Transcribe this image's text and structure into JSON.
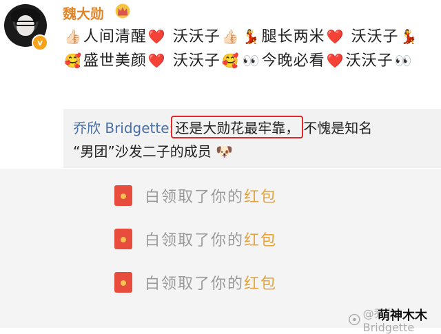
{
  "post": {
    "username": "魏大勋",
    "badge_icon": "crown-icon",
    "verified_mark": "v",
    "content_parts": [
      {
        "type": "emoji",
        "icon": "thumbs-up-icon",
        "glyph": "👍🏻"
      },
      {
        "type": "text",
        "text": "人间清醒"
      },
      {
        "type": "emoji",
        "icon": "heart-icon",
        "glyph": "❤️"
      },
      {
        "type": "text",
        "text": " 沃沃子"
      },
      {
        "type": "emoji",
        "icon": "thumbs-up-icon",
        "glyph": "👍🏻"
      },
      {
        "type": "emoji",
        "icon": "dancer-icon",
        "glyph": "💃"
      },
      {
        "type": "text",
        "text": "腿长两米"
      },
      {
        "type": "emoji",
        "icon": "heart-icon",
        "glyph": "❤️"
      },
      {
        "type": "text",
        "text": " 沃沃子"
      },
      {
        "type": "emoji",
        "icon": "dancer-icon",
        "glyph": "💃"
      },
      {
        "type": "emoji",
        "icon": "smiling-hearts-icon",
        "glyph": "🥰"
      },
      {
        "type": "text",
        "text": "盛世美颜"
      },
      {
        "type": "emoji",
        "icon": "heart-icon",
        "glyph": "❤️"
      },
      {
        "type": "text",
        "text": " 沃沃子"
      },
      {
        "type": "emoji",
        "icon": "smiling-hearts-icon",
        "glyph": "🥰"
      },
      {
        "type": "emoji",
        "icon": "eyes-icon",
        "glyph": "👀"
      },
      {
        "type": "text",
        "text": "今晚必看"
      },
      {
        "type": "emoji",
        "icon": "heart-icon",
        "glyph": "❤️"
      },
      {
        "type": "text",
        "text": "沃沃子"
      },
      {
        "type": "emoji",
        "icon": "eyes-icon",
        "glyph": "👀"
      }
    ]
  },
  "quote": {
    "name": "乔欣 Bridgette",
    "separator": ":",
    "highlight": "还是大勋花最牢靠，",
    "rest_line1": "不愧是知名",
    "line2": "“男团”沙发二子的成员",
    "line2_emoji_icon": "doge-icon",
    "line2_emoji": "🐶"
  },
  "packets": [
    {
      "prefix": "白领取了你的",
      "highlight": "红包"
    },
    {
      "prefix": "白领取了你的",
      "highlight": "红包"
    },
    {
      "prefix": "白领取了你的",
      "highlight": "红包"
    }
  ],
  "watermark": {
    "text": "@乔欣Bridgette",
    "author": "萌神木木"
  },
  "colors": {
    "username": "#e0862a",
    "quote_name": "#4a6fa5",
    "highlight_box": "#e5262a",
    "red_packet": "#e74c3c",
    "hongbao_text": "#e6a33c"
  }
}
